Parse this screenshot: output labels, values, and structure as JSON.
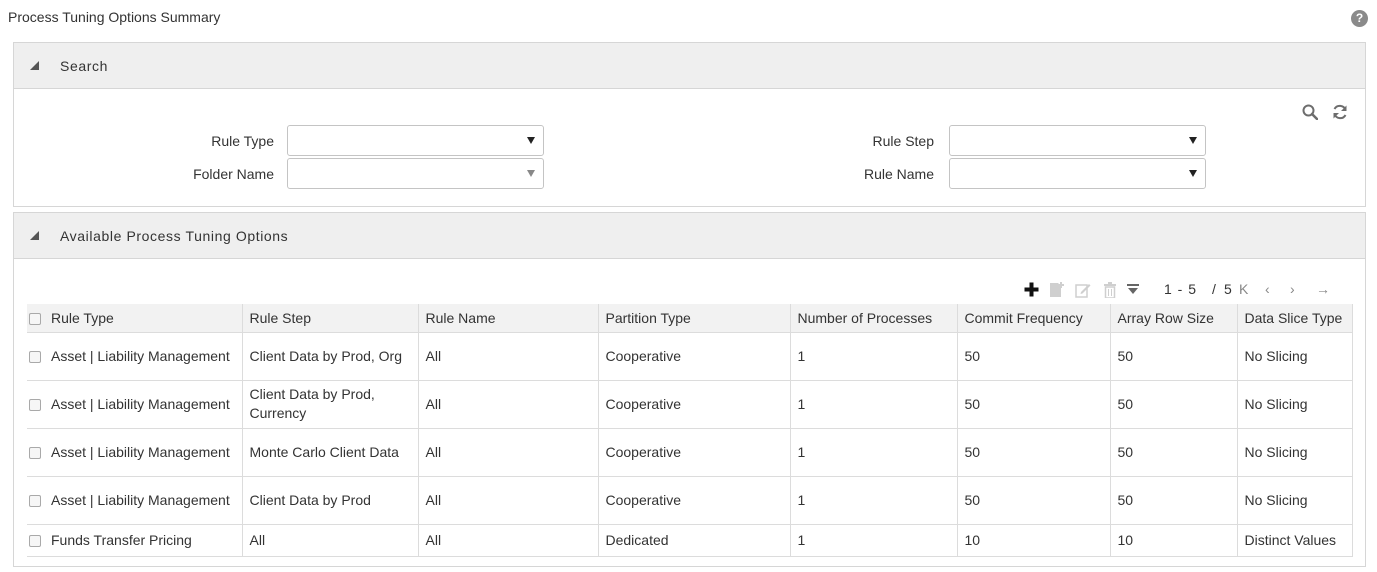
{
  "page": {
    "title": "Process Tuning Options Summary"
  },
  "search_panel": {
    "title": "Search",
    "fields": {
      "rule_type": {
        "label": "Rule Type",
        "value": ""
      },
      "folder_name": {
        "label": "Folder Name",
        "value": ""
      },
      "rule_step": {
        "label": "Rule Step",
        "value": ""
      },
      "rule_name": {
        "label": "Rule Name",
        "value": ""
      }
    },
    "icons": [
      "search-icon",
      "reset-icon"
    ]
  },
  "options_panel": {
    "title": "Available Process Tuning Options",
    "toolbar": [
      "add-icon",
      "copy-icon",
      "edit-icon",
      "delete-icon",
      "filter-icon"
    ],
    "pager": {
      "range": "1 - 5",
      "separator": "/",
      "total": "5"
    },
    "columns": [
      "Rule Type",
      "Rule Step",
      "Rule Name",
      "Partition Type",
      "Number of Processes",
      "Commit Frequency",
      "Array Row Size",
      "Data Slice Type"
    ],
    "rows": [
      [
        "Asset | Liability Management",
        "Client Data by Prod, Org",
        "All",
        "Cooperative",
        "1",
        "50",
        "50",
        "No Slicing"
      ],
      [
        "Asset | Liability Management",
        "Client Data by Prod, Currency",
        "All",
        "Cooperative",
        "1",
        "50",
        "50",
        "No Slicing"
      ],
      [
        "Asset | Liability Management",
        "Monte Carlo Client Data",
        "All",
        "Cooperative",
        "1",
        "50",
        "50",
        "No Slicing"
      ],
      [
        "Asset | Liability Management",
        "Client Data by Prod",
        "All",
        "Cooperative",
        "1",
        "50",
        "50",
        "No Slicing"
      ],
      [
        "Funds Transfer Pricing",
        "All",
        "All",
        "Dedicated",
        "1",
        "10",
        "10",
        "Distinct Values"
      ]
    ]
  },
  "colors": {
    "header_bg": "#efefef",
    "border": "#d6d6d6",
    "text": "#333333"
  }
}
